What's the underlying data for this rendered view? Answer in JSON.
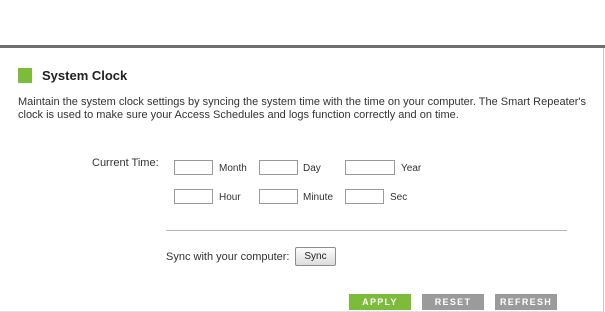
{
  "section": {
    "title": "System Clock",
    "description": "Maintain the system clock settings by syncing the system time with the time on your computer. The Smart Repeater's clock is used to make sure your Access Schedules and logs function correctly and on time."
  },
  "time_form": {
    "current_time_label": "Current Time:",
    "month": {
      "label": "Month",
      "value": ""
    },
    "day": {
      "label": "Day",
      "value": ""
    },
    "year": {
      "label": "Year",
      "value": ""
    },
    "hour": {
      "label": "Hour",
      "value": ""
    },
    "minute": {
      "label": "Minute",
      "value": ""
    },
    "sec": {
      "label": "Sec",
      "value": ""
    }
  },
  "sync": {
    "label": "Sync with your computer:",
    "button_label": "Sync"
  },
  "actions": {
    "apply": "APPLY",
    "reset": "RESET",
    "refresh": "REFRESH"
  },
  "colors": {
    "accent_green": "#7dbb3b",
    "neutral_button": "#9b9b9b",
    "top_rule": "#6e6e6e"
  }
}
